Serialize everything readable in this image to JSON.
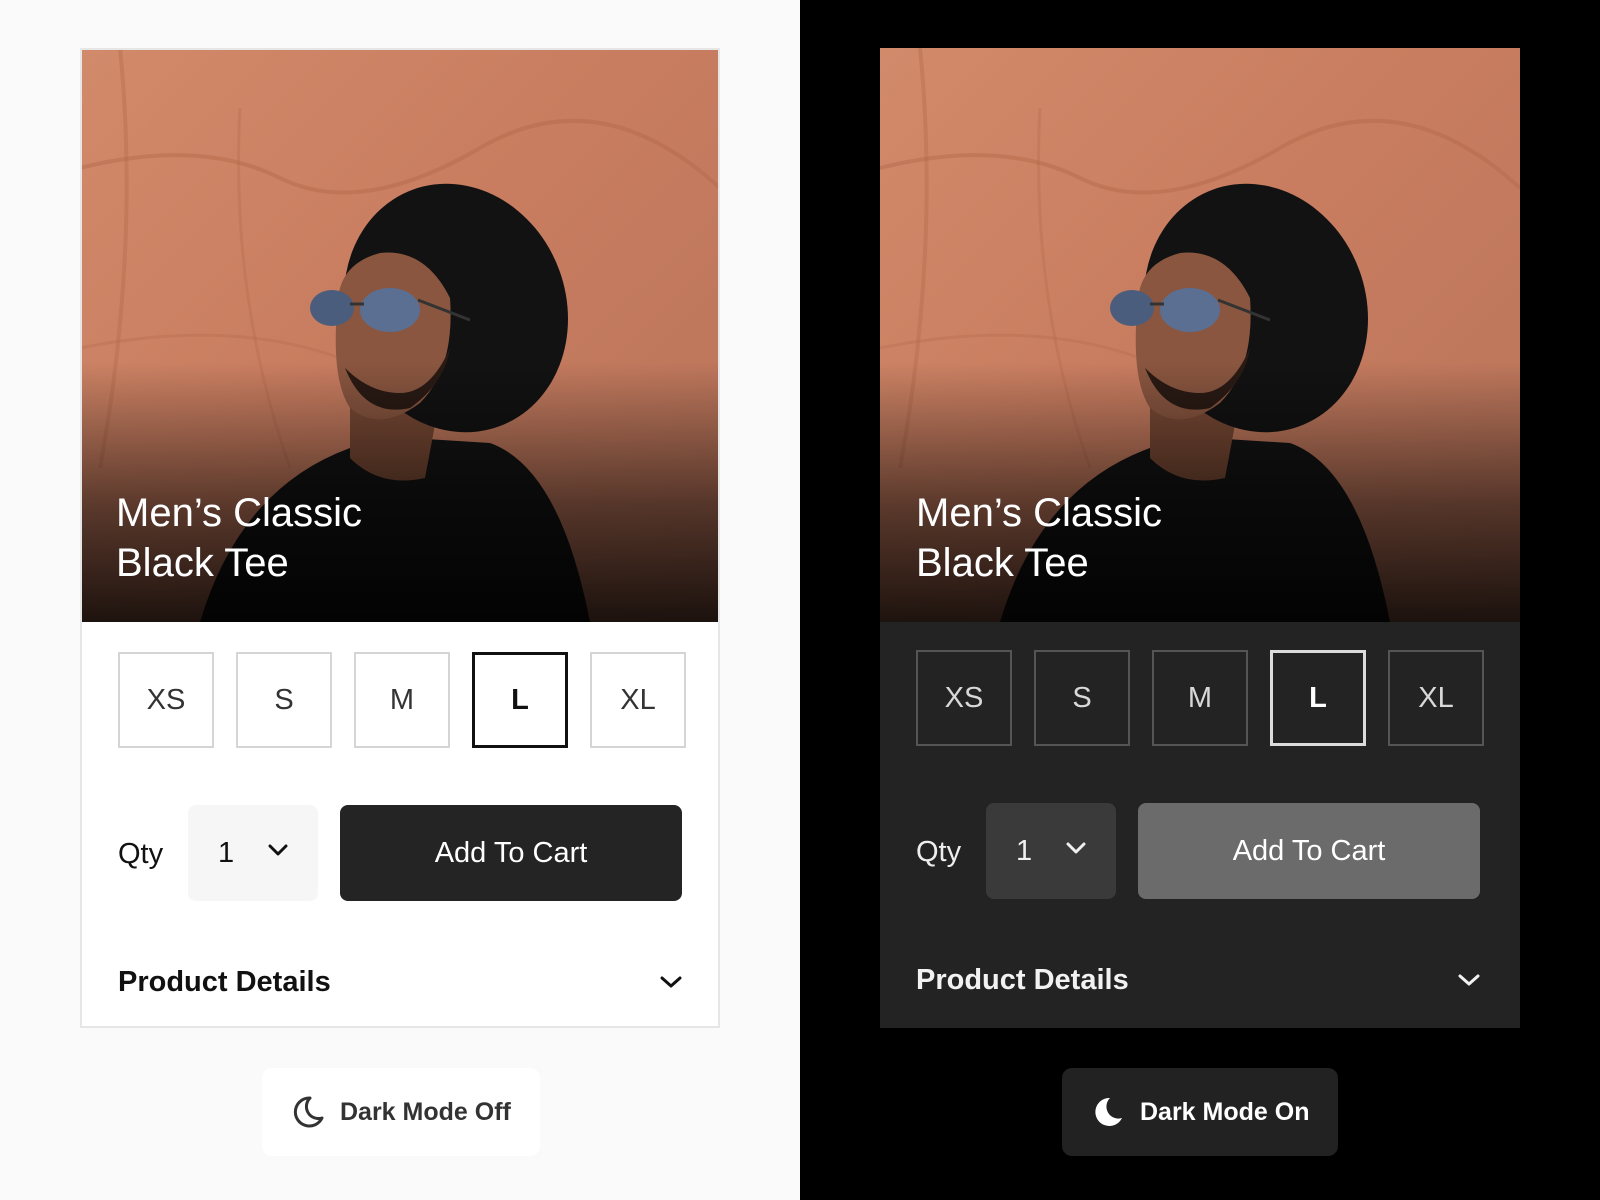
{
  "panels": {
    "light": {
      "product_title_line1": "Men’s Classic",
      "product_title_line2": "Black Tee",
      "sizes": [
        "XS",
        "S",
        "M",
        "L",
        "XL"
      ],
      "selected_size": "L",
      "qty_label": "Qty",
      "qty_value": "1",
      "add_to_cart": "Add To Cart",
      "product_details": "Product Details",
      "toggle_label": "Dark Mode Off"
    },
    "dark": {
      "product_title_line1": "Men’s Classic",
      "product_title_line2": "Black Tee",
      "sizes": [
        "XS",
        "S",
        "M",
        "L",
        "XL"
      ],
      "selected_size": "L",
      "qty_label": "Qty",
      "qty_value": "1",
      "add_to_cart": "Add To Cart",
      "product_details": "Product Details",
      "toggle_label": "Dark Mode On"
    }
  },
  "icons": {
    "qty_chevron": "chevron-down-icon",
    "details_chevron": "chevron-down-icon",
    "toggle_icon": "moon-icon"
  },
  "colors": {
    "light_bg": "#fafafa",
    "dark_bg": "#000000",
    "light_card": "#ffffff",
    "dark_card": "#232323",
    "cart_light": "#242424",
    "cart_dark": "#6b6b6b"
  }
}
